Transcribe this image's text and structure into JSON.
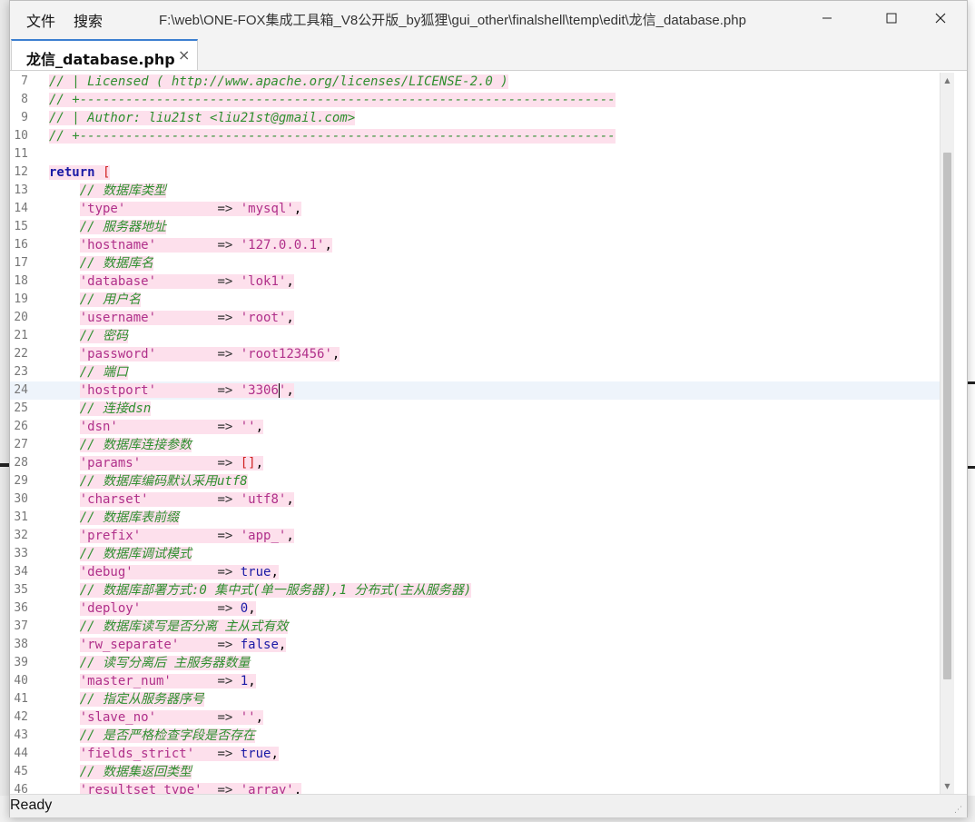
{
  "window": {
    "title": "F:\\web\\ONE-FOX集成工具箱_V8公开版_by狐狸\\gui_other\\finalshell\\temp\\edit\\龙信_database.php",
    "menu": [
      "文件",
      "搜索"
    ]
  },
  "tab": {
    "label": "龙信_database.php",
    "close": "×"
  },
  "status": {
    "text": "Ready"
  },
  "editor": {
    "cursor_line": 24,
    "lines": [
      {
        "n": "7",
        "text": "// | Licensed ( http://www.apache.org/licenses/LICENSE-2.0 )"
      },
      {
        "n": "8",
        "text": "// +----------------------------------------------------------------------"
      },
      {
        "n": "9",
        "text": "// | Author: liu21st <liu21st@gmail.com>"
      },
      {
        "n": "10",
        "text": "// +----------------------------------------------------------------------"
      },
      {
        "n": "11",
        "text": ""
      },
      {
        "n": "12",
        "text": "return ["
      },
      {
        "n": "13",
        "text": "    // 数据库类型"
      },
      {
        "n": "14",
        "text": "    'type'            => 'mysql',"
      },
      {
        "n": "15",
        "text": "    // 服务器地址"
      },
      {
        "n": "16",
        "text": "    'hostname'        => '127.0.0.1',"
      },
      {
        "n": "17",
        "text": "    // 数据库名"
      },
      {
        "n": "18",
        "text": "    'database'        => 'lok1',"
      },
      {
        "n": "19",
        "text": "    // 用户名"
      },
      {
        "n": "20",
        "text": "    'username'        => 'root',"
      },
      {
        "n": "21",
        "text": "    // 密码"
      },
      {
        "n": "22",
        "text": "    'password'        => 'root123456',"
      },
      {
        "n": "23",
        "text": "    // 端口"
      },
      {
        "n": "24",
        "text": "    'hostport'        => '3306',"
      },
      {
        "n": "25",
        "text": "    // 连接dsn"
      },
      {
        "n": "26",
        "text": "    'dsn'             => '',"
      },
      {
        "n": "27",
        "text": "    // 数据库连接参数"
      },
      {
        "n": "28",
        "text": "    'params'          => [],"
      },
      {
        "n": "29",
        "text": "    // 数据库编码默认采用utf8"
      },
      {
        "n": "30",
        "text": "    'charset'         => 'utf8',"
      },
      {
        "n": "31",
        "text": "    // 数据库表前缀"
      },
      {
        "n": "32",
        "text": "    'prefix'          => 'app_',"
      },
      {
        "n": "33",
        "text": "    // 数据库调试模式"
      },
      {
        "n": "34",
        "text": "    'debug'           => true,"
      },
      {
        "n": "35",
        "text": "    // 数据库部署方式:0 集中式(单一服务器),1 分布式(主从服务器)"
      },
      {
        "n": "36",
        "text": "    'deploy'          => 0,"
      },
      {
        "n": "37",
        "text": "    // 数据库读写是否分离 主从式有效"
      },
      {
        "n": "38",
        "text": "    'rw_separate'     => false,"
      },
      {
        "n": "39",
        "text": "    // 读写分离后 主服务器数量"
      },
      {
        "n": "40",
        "text": "    'master_num'      => 1,"
      },
      {
        "n": "41",
        "text": "    // 指定从服务器序号"
      },
      {
        "n": "42",
        "text": "    'slave_no'        => '',"
      },
      {
        "n": "43",
        "text": "    // 是否严格检查字段是否存在"
      },
      {
        "n": "44",
        "text": "    'fields_strict'   => true,"
      },
      {
        "n": "45",
        "text": "    // 数据集返回类型"
      },
      {
        "n": "46",
        "text": "    'resultset_type'  => 'array',"
      }
    ]
  }
}
